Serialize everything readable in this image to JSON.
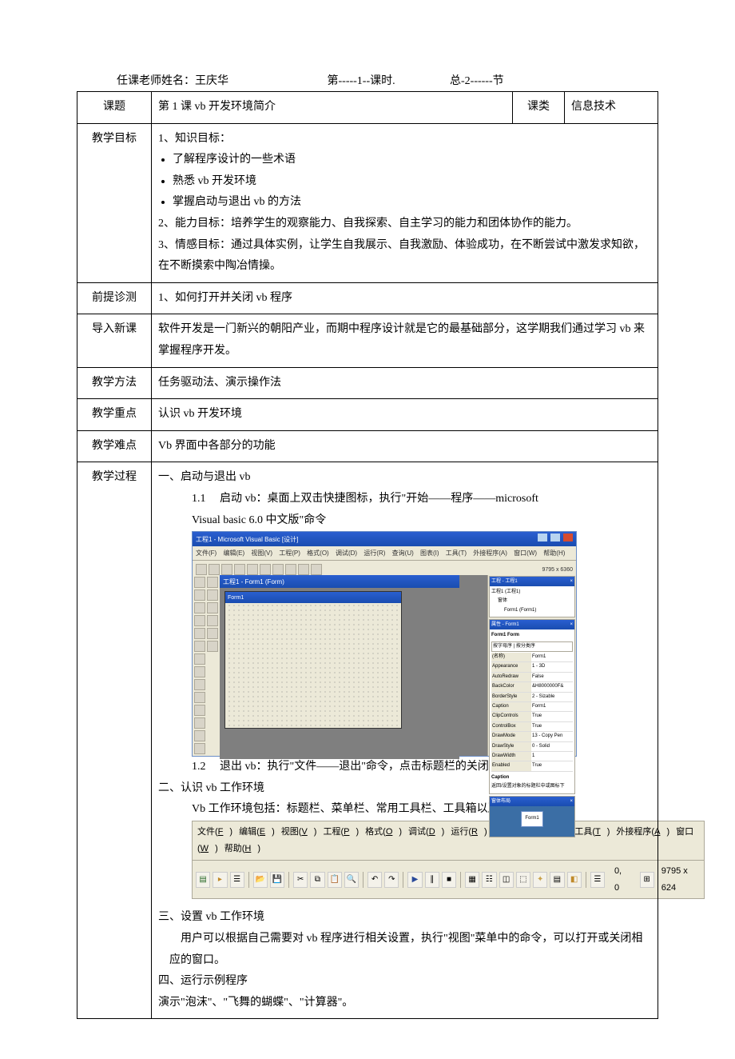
{
  "header": {
    "teacher_label": "任课老师姓名：王庆华",
    "period": "第-----1--课时.",
    "section": "总-2------节"
  },
  "rows": {
    "topic_label": "课题",
    "topic_value": "第 1 课  vb  开发环境简介",
    "lesson_type_label": "课类",
    "lesson_type_value": "信息技术",
    "objectives_label": "教学目标",
    "objectives": {
      "know_title": "1、知识目标：",
      "know_items": [
        "了解程序设计的一些术语",
        "熟悉 vb 开发环境",
        "掌握启动与退出 vb 的方法"
      ],
      "ability": "2、能力目标：培养学生的观察能力、自我探索、自主学习的能力和团体协作的能力。",
      "emotion": "3、情感目标：通过具体实例，让学生自我展示、自我激励、体验成功，在不断尝试中激发求知欲，在不断摸索中陶冶情操。"
    },
    "diag_label": "前提诊测",
    "diag_value": "1、如何打开并关闭 vb 程序",
    "intro_label": "导入新课",
    "intro_value": "软件开发是一门新兴的朝阳产业，而期中程序设计就是它的最基础部分，这学期我们通过学习 vb 来掌握程序开发。",
    "method_label": "教学方法",
    "method_value": "任务驱动法、演示操作法",
    "focus_label": "教学重点",
    "focus_value": "认识 vb 开发环境",
    "difficulty_label": "教学难点",
    "difficulty_value": "Vb 界面中各部分的功能",
    "process_label": "教学过程"
  },
  "process": {
    "s1_title": "一、启动与退出 vb",
    "s1_1": "1.1　 启动 vb：桌面上双击快捷图标，执行\"开始——程序——microsoft",
    "s1_1b": "Visual basic 6.0 中文版\"命令",
    "s1_2": "1.2　 退出 vb：执行\"文件——退出\"命令，点击标题栏的关闭按钮",
    "s2_title": "二、认识 vb 工作环境",
    "s2_body": "Vb 工作环境包括：标题栏、菜单栏、常用工具栏、工具箱以及窗口。",
    "s3_title": "三、设置 vb 工作环境",
    "s3_body": "用户可以根据自己需要对 vb 程序进行相关设置，执行\"视图\"菜单中的命令，可以打开或关闭相应的窗口。",
    "s4_title": "四、运行示例程序",
    "s4_body": "演示\"泡沫\"、\"飞舞的蝴蝶\"、\"计算器\"。"
  },
  "vb_ide": {
    "title": "工程1 - Microsoft Visual Basic [设计]",
    "menus": [
      "文件(F)",
      "编辑(E)",
      "视图(V)",
      "工程(P)",
      "格式(O)",
      "调试(D)",
      "运行(R)",
      "查询(U)",
      "图表(I)",
      "工具(T)",
      "外接程序(A)",
      "窗口(W)",
      "帮助(H)"
    ],
    "coords": "9795 x 6360",
    "formwin_title": "工程1 - Form1 (Form)",
    "form_title": "Form1",
    "project_panel": {
      "title": "工程 - 工程1",
      "root": "工程1 (工程1)",
      "folder": "窗体",
      "item": "Form1 (Form1)"
    },
    "props_panel": {
      "title": "属性 - Form1",
      "obj": "Form1 Form",
      "tabs": "按字母序 | 按分类序",
      "rows": [
        [
          "(名称)",
          "Form1"
        ],
        [
          "Appearance",
          "1 - 3D"
        ],
        [
          "AutoRedraw",
          "False"
        ],
        [
          "BackColor",
          "&H8000000F&"
        ],
        [
          "BorderStyle",
          "2 - Sizable"
        ],
        [
          "Caption",
          "Form1"
        ],
        [
          "ClipControls",
          "True"
        ],
        [
          "ControlBox",
          "True"
        ],
        [
          "DrawMode",
          "13 - Copy Pen"
        ],
        [
          "DrawStyle",
          "0 - Solid"
        ],
        [
          "DrawWidth",
          "1"
        ],
        [
          "Enabled",
          "True"
        ]
      ],
      "caption_label": "Caption",
      "caption_hint": "返回/设置对象的标题栏中或图标下"
    },
    "layout_panel": {
      "title": "窗体布局",
      "form": "Form1"
    }
  },
  "menubar": {
    "items": [
      {
        "t": "文件",
        "k": "F"
      },
      {
        "t": "编辑",
        "k": "E"
      },
      {
        "t": "视图",
        "k": "V"
      },
      {
        "t": "工程",
        "k": "P"
      },
      {
        "t": "格式",
        "k": "O"
      },
      {
        "t": "调试",
        "k": "D"
      },
      {
        "t": "运行",
        "k": "R"
      },
      {
        "t": "查询",
        "k": "U"
      },
      {
        "t": "图表",
        "k": "I"
      },
      {
        "t": "工具",
        "k": "T"
      },
      {
        "t": "外接程序",
        "k": "A"
      },
      {
        "t": "窗口",
        "k": "W"
      },
      {
        "t": "帮助",
        "k": "H"
      }
    ],
    "coord1": "0, 0",
    "coord2": "9795 x 624"
  }
}
